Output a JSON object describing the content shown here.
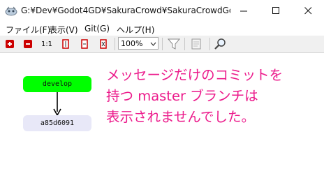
{
  "window": {
    "title": "G:¥Dev¥Godot4GD¥SakuraCrowd¥SakuraCrowdGodot...",
    "icon": "git-graph-app-icon"
  },
  "menu": [
    "ファイル(F)",
    "表示(V)",
    "Git(G)",
    "ヘルプ(H)"
  ],
  "toolbar": {
    "zoom_in": "zoom-in-icon",
    "zoom_out": "zoom-out-icon",
    "actual_size": "1:1",
    "zoom_value": "100%",
    "filter": "filter-icon",
    "search": "magnifier-icon"
  },
  "graph": {
    "branch_label": "develop",
    "commit_hash": "a85d6091",
    "branch_color": "#00ff00",
    "commit_color": "#e8e8f8"
  },
  "annotation": {
    "text": "メッセージだけのコミットを\n持つ master ブランチは\n表示されませんでした。",
    "color": "#ec1c8c"
  }
}
